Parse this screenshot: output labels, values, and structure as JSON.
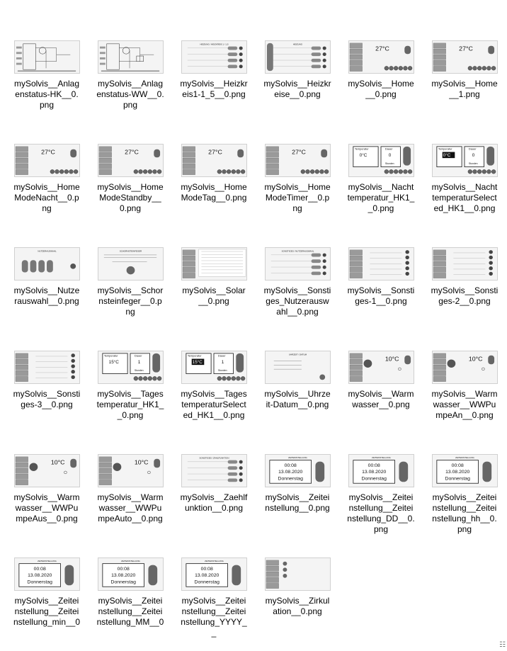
{
  "files": [
    {
      "name": "mySolvis__Anlagenstatus-HK__0.png",
      "kind": "diagram"
    },
    {
      "name": "mySolvis__Anlagenstatus-WW__0.png",
      "kind": "diagram2"
    },
    {
      "name": "mySolvis__Heizkreis1-1_5__0.png",
      "kind": "list",
      "title": "HEIZUNG / HEIZKREIS 1 / 1,5"
    },
    {
      "name": "mySolvis__Heizkreise__0.png",
      "kind": "menu",
      "title": "HEIZUNG"
    },
    {
      "name": "mySolvis__Home__0.png",
      "kind": "home",
      "temp": "27°C"
    },
    {
      "name": "mySolvis__Home__1.png",
      "kind": "home",
      "temp": "27°C"
    },
    {
      "name": "mySolvis__HomeModeNacht__0.png",
      "kind": "home",
      "temp": "27°C"
    },
    {
      "name": "mySolvis__HomeModeStandby__0.png",
      "kind": "home",
      "temp": "27°C"
    },
    {
      "name": "mySolvis__HomeModeTag__0.png",
      "kind": "home",
      "temp": "27°C"
    },
    {
      "name": "mySolvis__HomeModeTimer__0.png",
      "kind": "home",
      "temp": "27°C"
    },
    {
      "name": "mySolvis__Nachttemperatur_HK1__0.png",
      "kind": "dual",
      "left": "Temperatur",
      "right": "Dauer",
      "val1": "0°C",
      "val2": "0",
      "unit": "Stunden"
    },
    {
      "name": "mySolvis__NachttemperaturSelected_HK1__0.png",
      "kind": "dual",
      "left": "Temperatur",
      "right": "Dauer",
      "val1": "0°C",
      "val2": "0",
      "unit": "Stunden",
      "selected": true
    },
    {
      "name": "mySolvis__Nutzerauswahl__0.png",
      "kind": "code",
      "title": "NUTZERAUSWAHL"
    },
    {
      "name": "mySolvis__Schornsteinfeger__0.png",
      "kind": "text",
      "title": "SCHORNSTEINFEGER"
    },
    {
      "name": "mySolvis__Solar__0.png",
      "kind": "solar"
    },
    {
      "name": "mySolvis__Sonstiges_Nutzerauswahl__0.png",
      "kind": "list",
      "title": "SONSTIGES / NUTZERAUSWAHL"
    },
    {
      "name": "mySolvis__Sonstiges-1__0.png",
      "kind": "sidemenu"
    },
    {
      "name": "mySolvis__Sonstiges-2__0.png",
      "kind": "sidemenu"
    },
    {
      "name": "mySolvis__Sonstiges-3__0.png",
      "kind": "sidemenu"
    },
    {
      "name": "mySolvis__Tagestemperatur_HK1__0.png",
      "kind": "dual",
      "left": "Temperatur",
      "right": "Dauer",
      "val1": "15°C",
      "val2": "1",
      "unit": "Stunden"
    },
    {
      "name": "mySolvis__TagestemperaturSelected_HK1__0.png",
      "kind": "dual",
      "left": "Temperatur",
      "right": "Dauer",
      "val1": "15°C",
      "val2": "1",
      "unit": "Stunden",
      "selected": true
    },
    {
      "name": "mySolvis__Uhrzeit-Datum__0.png",
      "kind": "clock",
      "title": "UHRZEIT / DATUM"
    },
    {
      "name": "mySolvis__Warmwasser__0.png",
      "kind": "ww",
      "temp": "10°C"
    },
    {
      "name": "mySolvis__Warmwasser__WWPumpeAn__0.png",
      "kind": "ww",
      "temp": "10°C"
    },
    {
      "name": "mySolvis__Warmwasser__WWPumpeAus__0.png",
      "kind": "ww",
      "temp": "10°C"
    },
    {
      "name": "mySolvis__Warmwasser__WWPumpeAuto__0.png",
      "kind": "ww",
      "temp": "10°C"
    },
    {
      "name": "mySolvis__Zaehlfunktion__0.png",
      "kind": "list",
      "title": "SONSTIGES / ZÄHLFUNKTION"
    },
    {
      "name": "mySolvis__Zeiteinstellung__0.png",
      "kind": "time",
      "title": "ZEITEINSTELLUNG",
      "time": "00:08",
      "date": "13.08.2020",
      "day": "Donnerstag"
    },
    {
      "name": "mySolvis__Zeiteinstellung__Zeiteinstellung_DD__0.png",
      "kind": "time",
      "title": "ZEITEINSTELLUNG",
      "time": "00:08",
      "date": "13.08.2020",
      "day": "Donnerstag"
    },
    {
      "name": "mySolvis__Zeiteinstellung__Zeiteinstellung_hh__0.png",
      "kind": "time",
      "title": "ZEITEINSTELLUNG",
      "time": "00:08",
      "date": "13.08.2020",
      "day": "Donnerstag"
    },
    {
      "name": "mySolvis__Zeiteinstellung__Zeiteinstellung_min__0",
      "kind": "time",
      "title": "ZEITEINSTELLUNG",
      "time": "00:08",
      "date": "13.08.2020",
      "day": "Donnerstag"
    },
    {
      "name": "mySolvis__Zeiteinstellung__Zeiteinstellung_MM__0",
      "kind": "time",
      "title": "ZEITEINSTELLUNG",
      "time": "00:08",
      "date": "13.08.2020",
      "day": "Donnerstag"
    },
    {
      "name": "mySolvis__Zeiteinstellung__Zeiteinstellung_YYYY__",
      "kind": "time",
      "title": "ZEITEINSTELLUNG",
      "time": "00:08",
      "date": "13.08.2020",
      "day": "Donnerstag"
    },
    {
      "name": "mySolvis__Zirkulation__0.png",
      "kind": "zirk"
    }
  ],
  "status_glyph": "☷"
}
